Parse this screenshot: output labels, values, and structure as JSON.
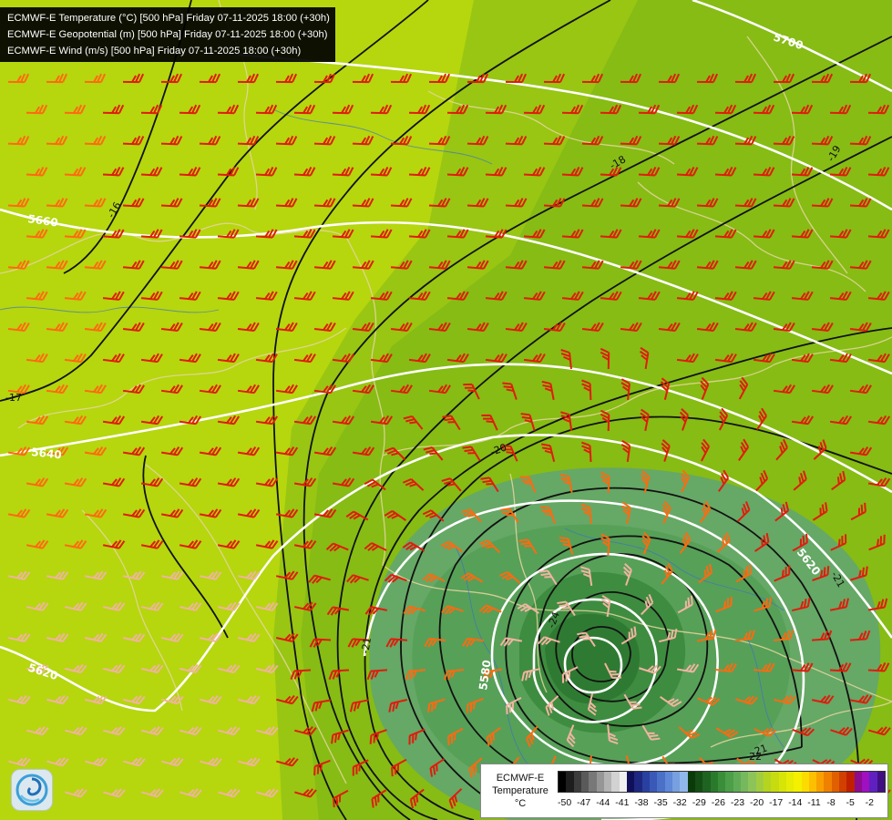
{
  "header": {
    "lines": [
      "ECMWF-E Temperature (°C) [500 hPa] Friday 07-11-2025 18:00 (+30h)",
      "ECMWF-E Geopotential (m) [500 hPa] Friday 07-11-2025 18:00 (+30h)",
      "ECMWF-E Wind (m/s) [500 hPa] Friday 07-11-2025 18:00 (+30h)"
    ]
  },
  "map": {
    "geopotential_labels": [
      "5700",
      "5660",
      "5640",
      "5620",
      "5620",
      "5580"
    ],
    "temperature_labels": [
      "-16",
      "-17",
      "-18",
      "-19",
      "-20",
      "-21",
      "-21",
      "-21",
      "-22",
      "-24"
    ],
    "colors": {
      "warm_fill": "#b6d60e",
      "mid_fill": "#86bc14",
      "cold_fill": "#66a866",
      "core_fill": "#2f7a32",
      "geopotential_contour": "#ffffff",
      "temperature_contour": "#111111",
      "wind_barb_strong": "#e01c0c",
      "wind_barb_moderate": "#ff6a10",
      "wind_barb_weak": "#f0b4a0",
      "border_line": "#e6d7a0"
    }
  },
  "legend": {
    "label_lines": [
      "ECMWF-E",
      "Temperature",
      "°C"
    ],
    "ticks": [
      "-50",
      "-47",
      "-44",
      "-41",
      "-38",
      "-35",
      "-32",
      "-29",
      "-26",
      "-23",
      "-20",
      "-17",
      "-14",
      "-11",
      "-8",
      "-5",
      "-2"
    ],
    "swatches": [
      "#000000",
      "#1e1e1e",
      "#3c3c3c",
      "#5a5a5a",
      "#787878",
      "#969696",
      "#b4b4b4",
      "#d2d2d2",
      "#f0f0f0",
      "#10105a",
      "#1e2880",
      "#2a40a0",
      "#3a58b8",
      "#4a70c8",
      "#6088d8",
      "#78a0e0",
      "#90b8ec",
      "#0a3a0a",
      "#144e14",
      "#1e6420",
      "#2a7a2c",
      "#3a8e3a",
      "#4c9e48",
      "#60ac56",
      "#76b85e",
      "#8cc45a",
      "#a2cc40",
      "#b4d420",
      "#c6dc10",
      "#d6e408",
      "#e6ec04",
      "#f4f000",
      "#fcdc00",
      "#fcc000",
      "#f8a000",
      "#f08000",
      "#e06000",
      "#d04000",
      "#c02000",
      "#8c0c8c",
      "#a010c0",
      "#6020c0",
      "#401080"
    ]
  },
  "logo": {
    "icon": "swirl-logo-icon"
  }
}
